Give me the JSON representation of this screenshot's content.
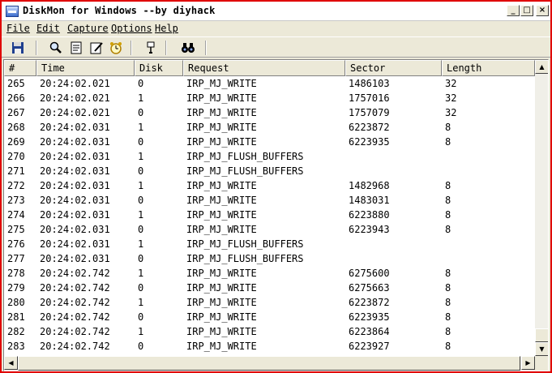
{
  "window": {
    "title": "DiskMon for Windows --by diyhack"
  },
  "titlebar": {
    "min": "_",
    "max": "□",
    "close": "×"
  },
  "menu": [
    "File",
    "Edit",
    "Capture",
    "Options",
    "Help"
  ],
  "toolbar": {
    "icons": [
      "save-icon",
      "find-icon",
      "properties-icon",
      "edit-icon",
      "clock-icon",
      "filter-icon",
      "binoculars-icon"
    ]
  },
  "columns": [
    "#",
    "Time",
    "Disk",
    "Request",
    "Sector",
    "Length"
  ],
  "rows": [
    [
      "265",
      "20:24:02.021",
      "0",
      "IRP_MJ_WRITE",
      "1486103",
      "32"
    ],
    [
      "266",
      "20:24:02.021",
      "1",
      "IRP_MJ_WRITE",
      "1757016",
      "32"
    ],
    [
      "267",
      "20:24:02.021",
      "0",
      "IRP_MJ_WRITE",
      "1757079",
      "32"
    ],
    [
      "268",
      "20:24:02.031",
      "1",
      "IRP_MJ_WRITE",
      "6223872",
      "8"
    ],
    [
      "269",
      "20:24:02.031",
      "0",
      "IRP_MJ_WRITE",
      "6223935",
      "8"
    ],
    [
      "270",
      "20:24:02.031",
      "1",
      "IRP_MJ_FLUSH_BUFFERS",
      "",
      ""
    ],
    [
      "271",
      "20:24:02.031",
      "0",
      "IRP_MJ_FLUSH_BUFFERS",
      "",
      ""
    ],
    [
      "272",
      "20:24:02.031",
      "1",
      "IRP_MJ_WRITE",
      "1482968",
      "8"
    ],
    [
      "273",
      "20:24:02.031",
      "0",
      "IRP_MJ_WRITE",
      "1483031",
      "8"
    ],
    [
      "274",
      "20:24:02.031",
      "1",
      "IRP_MJ_WRITE",
      "6223880",
      "8"
    ],
    [
      "275",
      "20:24:02.031",
      "0",
      "IRP_MJ_WRITE",
      "6223943",
      "8"
    ],
    [
      "276",
      "20:24:02.031",
      "1",
      "IRP_MJ_FLUSH_BUFFERS",
      "",
      ""
    ],
    [
      "277",
      "20:24:02.031",
      "0",
      "IRP_MJ_FLUSH_BUFFERS",
      "",
      ""
    ],
    [
      "278",
      "20:24:02.742",
      "1",
      "IRP_MJ_WRITE",
      "6275600",
      "8"
    ],
    [
      "279",
      "20:24:02.742",
      "0",
      "IRP_MJ_WRITE",
      "6275663",
      "8"
    ],
    [
      "280",
      "20:24:02.742",
      "1",
      "IRP_MJ_WRITE",
      "6223872",
      "8"
    ],
    [
      "281",
      "20:24:02.742",
      "0",
      "IRP_MJ_WRITE",
      "6223935",
      "8"
    ],
    [
      "282",
      "20:24:02.742",
      "1",
      "IRP_MJ_WRITE",
      "6223864",
      "8"
    ],
    [
      "283",
      "20:24:02.742",
      "0",
      "IRP_MJ_WRITE",
      "6223927",
      "8"
    ]
  ],
  "scrollbars": {
    "up": "▲",
    "down": "▼",
    "left": "◀",
    "right": "▶"
  },
  "colors": {
    "window_border": "#e00000",
    "chrome": "#ece9d8",
    "list_bg": "#ffffff"
  }
}
